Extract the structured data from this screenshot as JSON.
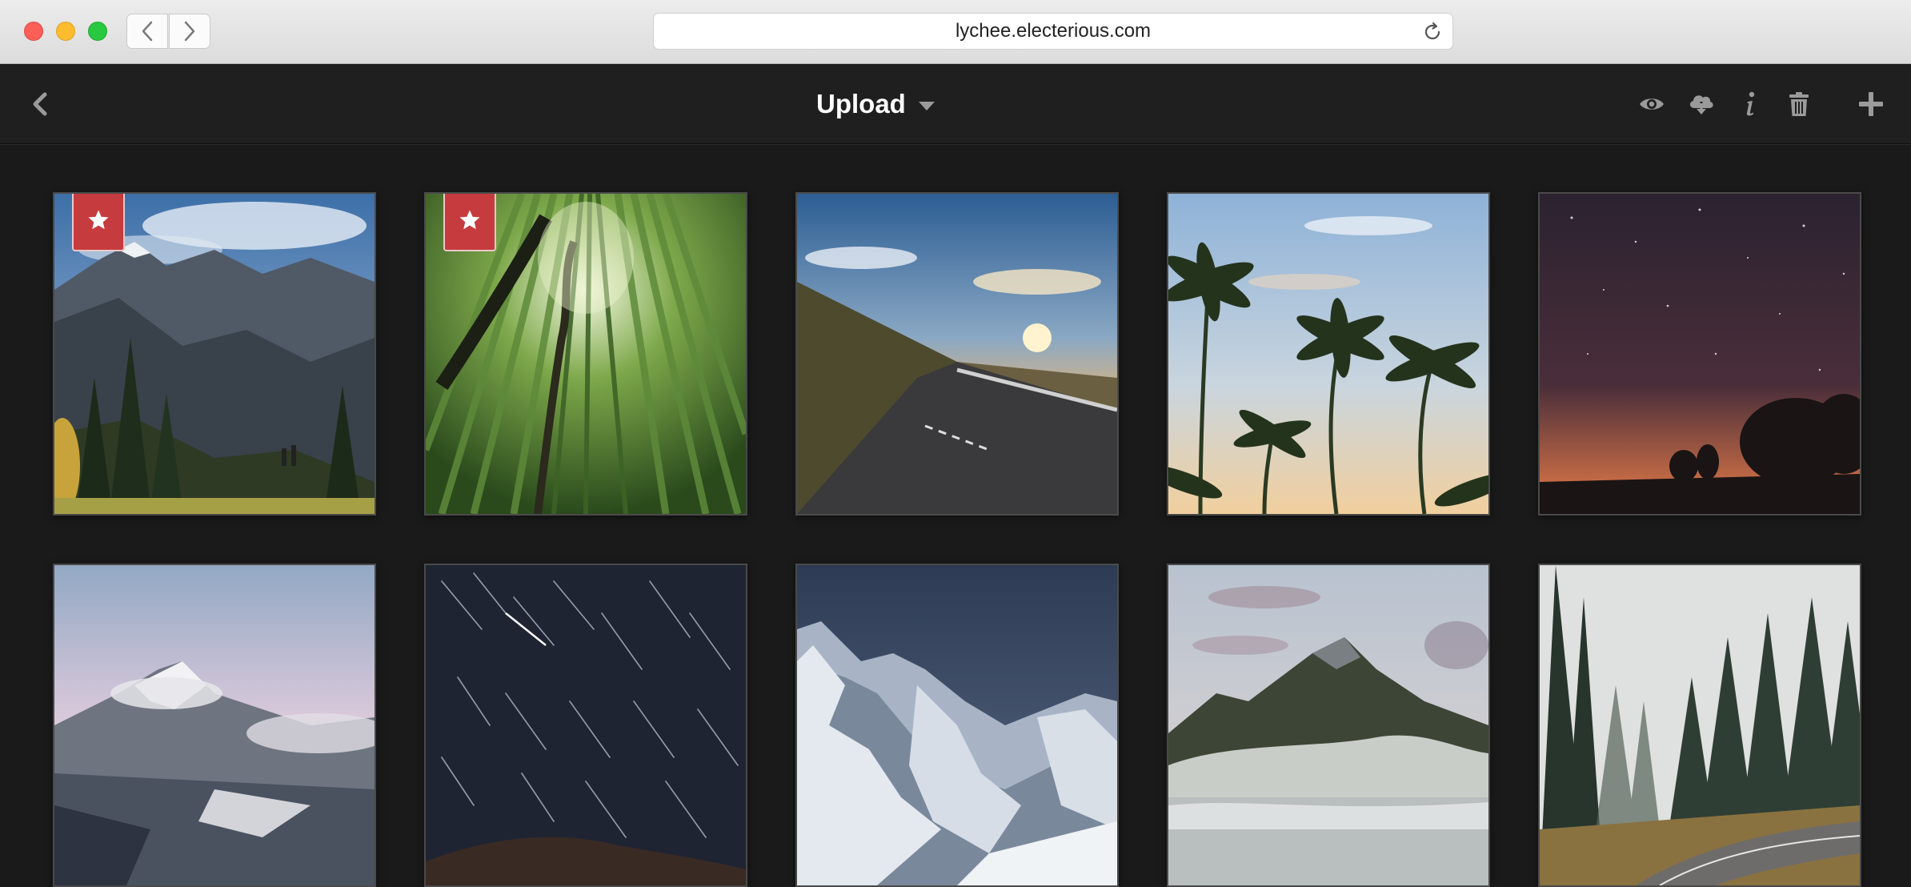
{
  "browser": {
    "url": "lychee.electerious.com"
  },
  "header": {
    "title": "Upload"
  },
  "icons": {
    "back": "chevron-left-icon",
    "dropdown": "caret-down-icon",
    "visibility": "eye-icon",
    "download": "cloud-download-icon",
    "info": "info-icon",
    "delete": "trash-icon",
    "add": "plus-icon",
    "star": "star-icon"
  },
  "colors": {
    "chrome_bg": "#e4e4e4",
    "app_bg": "#1a1a1a",
    "header_bg": "#1f1f1f",
    "star_badge": "#c63b3d",
    "icon_gray": "#9a9a9a"
  },
  "photos": [
    {
      "scene": "mountain-valley-hikers",
      "starred": true
    },
    {
      "scene": "bamboo-forest",
      "starred": true
    },
    {
      "scene": "sunset-road",
      "starred": false
    },
    {
      "scene": "palm-trees",
      "starred": false
    },
    {
      "scene": "starry-night-trees",
      "starred": false
    },
    {
      "scene": "snowy-mountain-clouds",
      "starred": false
    },
    {
      "scene": "star-trails",
      "starred": false
    },
    {
      "scene": "glacier-peaks",
      "starred": false
    },
    {
      "scene": "misty-mountain-lake",
      "starred": false
    },
    {
      "scene": "foggy-forest-road",
      "starred": false
    }
  ]
}
